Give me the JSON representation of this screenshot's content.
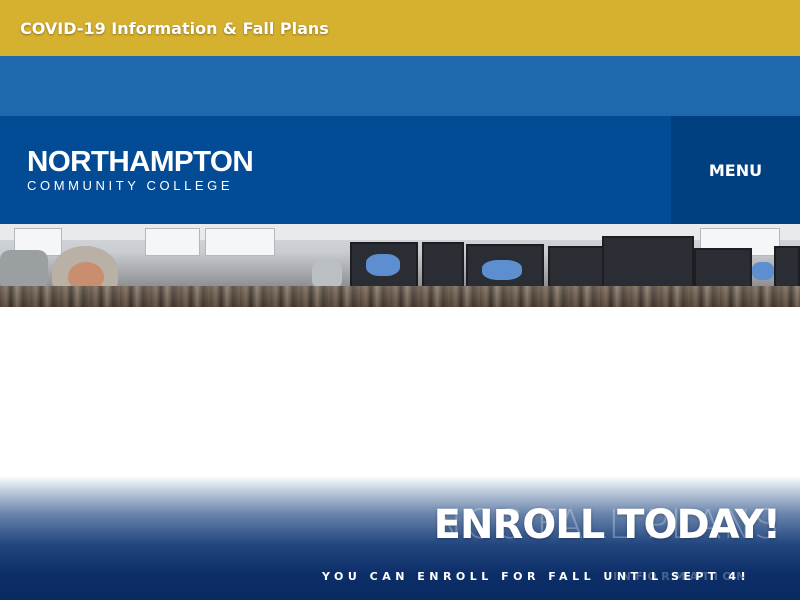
{
  "alert": {
    "label": "COVID-19 Information & Fall Plans"
  },
  "header": {
    "logo": {
      "name": "NORTHAMPTON",
      "subtitle": "COMMUNITY COLLEGE"
    },
    "menu_label": "MENU"
  },
  "hero": {
    "photo_icon": "students-in-computer-lab-photo"
  },
  "banner": {
    "ghost_title": "NCC FALL PLANS",
    "title": "ENROLL TODAY!",
    "ghost_subtitle": "INFORMATION",
    "subtitle": "YOU CAN ENROLL FOR FALL UNTIL SEPT 4!"
  },
  "colors": {
    "alert_bg": "#d6b02f",
    "utility_bg": "#1f68ad",
    "header_bg": "#034b94",
    "menu_bg": "#003f80",
    "banner_bottom": "#0a2a61"
  }
}
